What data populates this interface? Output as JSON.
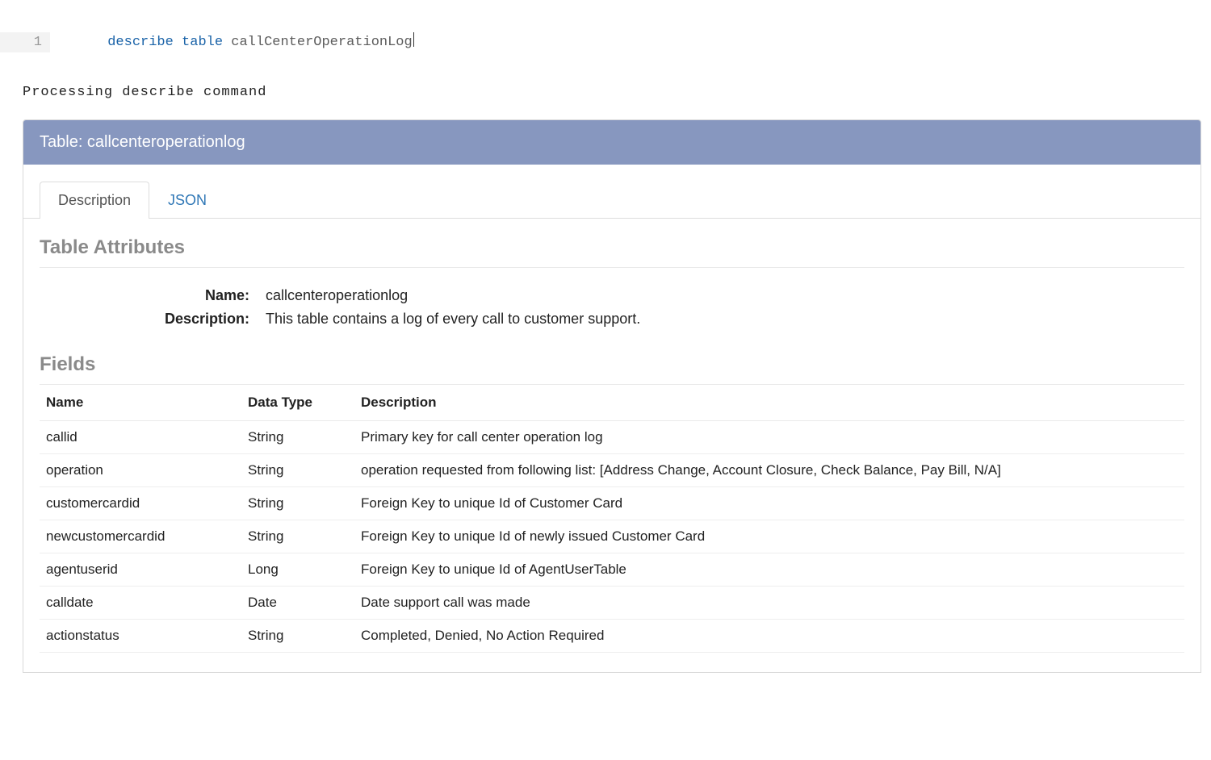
{
  "code": {
    "line_number": "1",
    "tokens": {
      "kw1": "describe",
      "kw2": "table",
      "ident": "callCenterOperationLog"
    }
  },
  "status": "Processing describe command",
  "panel": {
    "title": "Table: callcenteroperationlog",
    "tabs": [
      {
        "label": "Description",
        "active": true
      },
      {
        "label": "JSON",
        "active": false
      }
    ],
    "attributes_heading": "Table Attributes",
    "attributes": {
      "name_label": "Name:",
      "name_value": "callcenteroperationlog",
      "description_label": "Description:",
      "description_value": "This table contains a log of every call to customer support."
    },
    "fields_heading": "Fields",
    "fields_columns": {
      "name": "Name",
      "type": "Data Type",
      "desc": "Description"
    },
    "fields": [
      {
        "name": "callid",
        "type": "String",
        "desc": "Primary key for call center operation log"
      },
      {
        "name": "operation",
        "type": "String",
        "desc": "operation requested from following list: [Address Change, Account Closure, Check Balance, Pay Bill, N/A]"
      },
      {
        "name": "customercardid",
        "type": "String",
        "desc": "Foreign Key to unique Id of Customer Card"
      },
      {
        "name": "newcustomercardid",
        "type": "String",
        "desc": "Foreign Key to unique Id of newly issued Customer Card"
      },
      {
        "name": "agentuserid",
        "type": "Long",
        "desc": "Foreign Key to unique Id of AgentUserTable"
      },
      {
        "name": "calldate",
        "type": "Date",
        "desc": "Date support call was made"
      },
      {
        "name": "actionstatus",
        "type": "String",
        "desc": "Completed, Denied, No Action Required"
      }
    ]
  }
}
